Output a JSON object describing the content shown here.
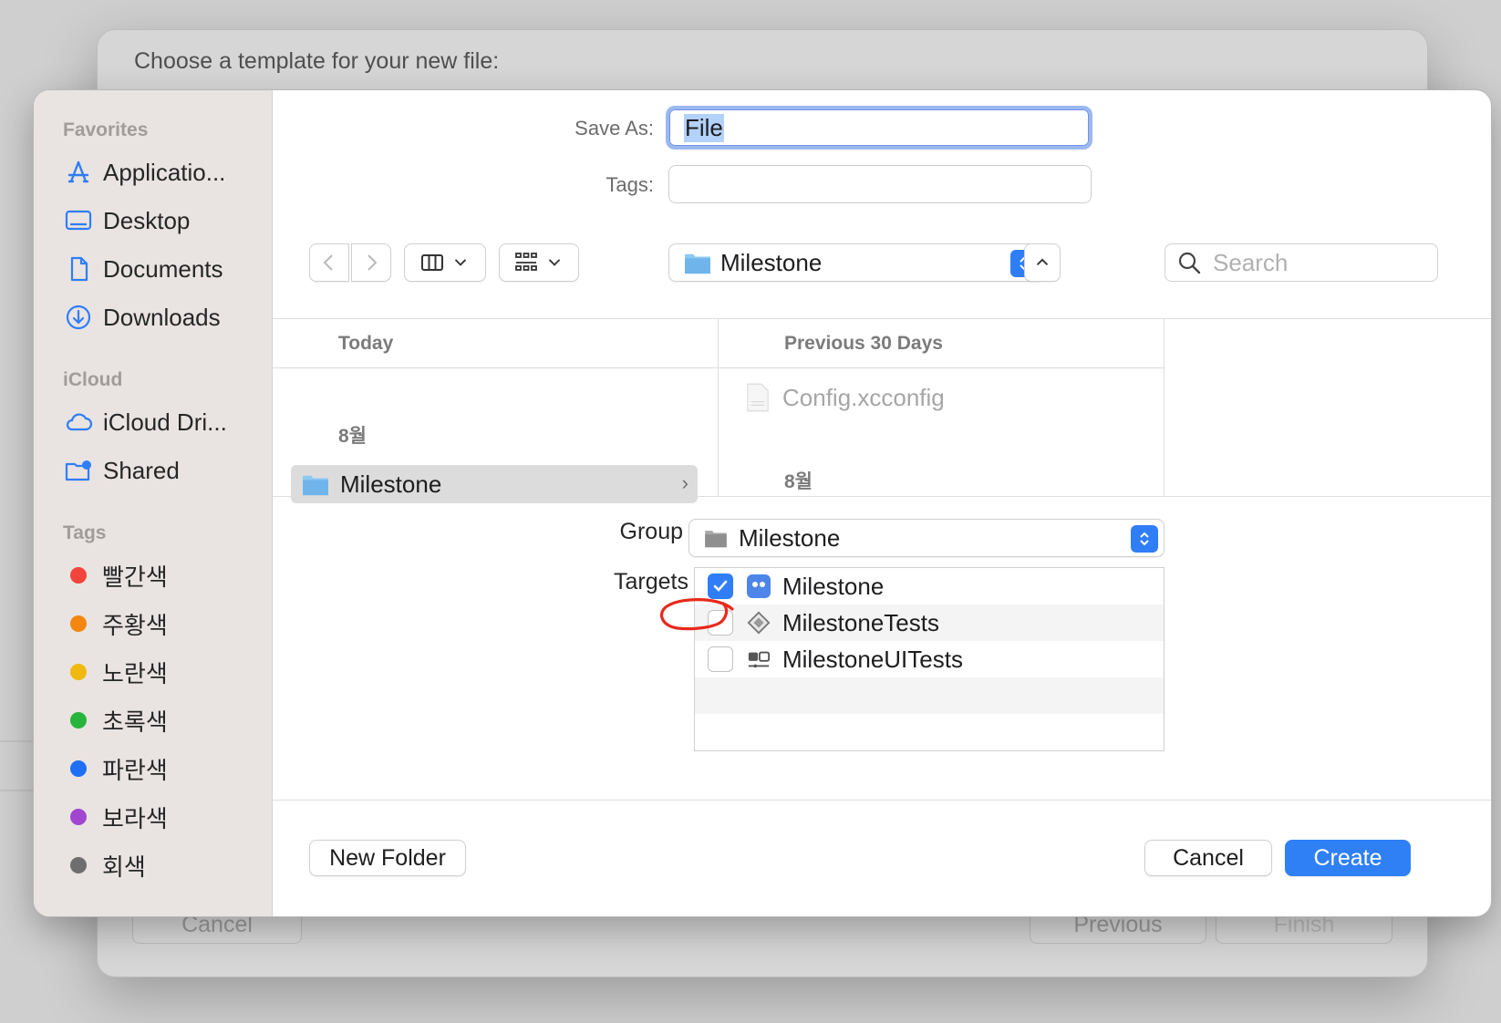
{
  "parent": {
    "title": "Choose a template for your new file:",
    "cancel_label": "Cancel",
    "previous_label": "Previous",
    "finish_label": "Finish"
  },
  "sidebar": {
    "favorites_title": "Favorites",
    "favorites": [
      {
        "label": "Applicatio...",
        "icon": "applications-icon"
      },
      {
        "label": "Desktop",
        "icon": "desktop-icon"
      },
      {
        "label": "Documents",
        "icon": "document-icon"
      },
      {
        "label": "Downloads",
        "icon": "download-icon"
      }
    ],
    "icloud_title": "iCloud",
    "icloud": [
      {
        "label": "iCloud Dri...",
        "icon": "cloud-icon"
      },
      {
        "label": "Shared",
        "icon": "shared-folder-icon"
      }
    ],
    "tags_title": "Tags",
    "tags": [
      {
        "label": "빨간색",
        "color": "#f2443a"
      },
      {
        "label": "주황색",
        "color": "#f3870f"
      },
      {
        "label": "노란색",
        "color": "#f1b90e"
      },
      {
        "label": "초록색",
        "color": "#27b43a"
      },
      {
        "label": "파란색",
        "color": "#1e6ff5"
      },
      {
        "label": "보라색",
        "color": "#a146d0"
      },
      {
        "label": "회색",
        "color": "#6e6e6e"
      }
    ]
  },
  "save_as": {
    "label": "Save As:",
    "value": "File"
  },
  "tags_field": {
    "label": "Tags:",
    "value": ""
  },
  "toolbar": {
    "location": "Milestone",
    "search_placeholder": "Search"
  },
  "browser": {
    "col1_header": "Today",
    "col1_subheader": "8월",
    "col1_selected": "Milestone",
    "col2_header": "Previous 30 Days",
    "col2_file": "Config.xcconfig",
    "col2_subheader": "8월"
  },
  "options": {
    "group_label": "Group",
    "group_value": "Milestone",
    "targets_label": "Targets",
    "targets": [
      {
        "label": "Milestone",
        "checked": true
      },
      {
        "label": "MilestoneTests",
        "checked": false
      },
      {
        "label": "MilestoneUITests",
        "checked": false
      }
    ]
  },
  "buttons": {
    "new_folder": "New Folder",
    "cancel": "Cancel",
    "create": "Create"
  },
  "colors": {
    "accent": "#2f7ef7",
    "annotation": "#e8291c"
  }
}
